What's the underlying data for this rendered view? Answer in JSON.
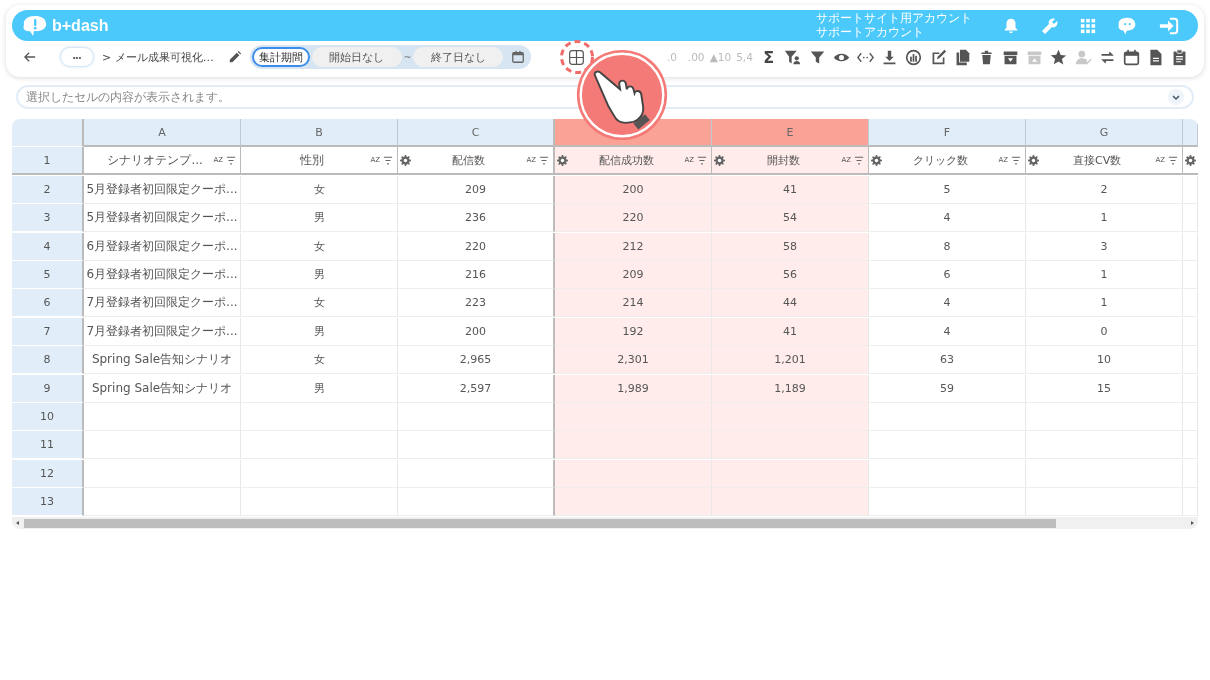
{
  "header": {
    "logo": "b+dash",
    "account": [
      "サポートサイト用アカウント",
      "サポートアカウント"
    ]
  },
  "breadcrumb": {
    "more": "•••",
    "title": "> メール成果可視化…"
  },
  "period": {
    "tabs": [
      {
        "label": "集計期間",
        "selected": true
      },
      {
        "label": "開始日なし",
        "selected": false
      }
    ],
    "separator": "~",
    "end": "終了日なし"
  },
  "toolbar": [
    {
      "kind": "icon",
      "disabled": false,
      "highlighted": true
    },
    {
      "kind": "text",
      "label": ".0",
      "disabled": true
    },
    {
      "kind": "text",
      "label": ".00",
      "disabled": true
    },
    {
      "kind": "text",
      "label": "▲10",
      "disabled": true
    },
    {
      "kind": "text",
      "label": "5,4",
      "disabled": true
    },
    {
      "kind": "text",
      "label": "Σ",
      "disabled": false
    },
    {
      "kind": "icon",
      "disabled": false
    },
    {
      "kind": "icon",
      "disabled": false
    },
    {
      "kind": "icon",
      "disabled": false
    },
    {
      "kind": "icon",
      "disabled": false
    },
    {
      "kind": "icon",
      "disabled": false
    },
    {
      "kind": "icon",
      "disabled": false
    },
    {
      "kind": "icon",
      "disabled": false
    },
    {
      "kind": "icon",
      "disabled": false
    },
    {
      "kind": "icon",
      "disabled": false
    },
    {
      "kind": "icon",
      "disabled": false
    },
    {
      "kind": "icon",
      "disabled": true
    },
    {
      "kind": "icon",
      "disabled": false
    },
    {
      "kind": "icon",
      "disabled": true
    },
    {
      "kind": "icon",
      "disabled": false
    },
    {
      "kind": "icon",
      "disabled": false
    },
    {
      "kind": "icon",
      "disabled": false
    },
    {
      "kind": "icon",
      "disabled": false
    }
  ],
  "formula_bar": {
    "placeholder": "選択したセルの内容が表示されます。"
  },
  "table": {
    "columns": [
      {
        "letter": "A",
        "title": "シナリオテンプ...",
        "sort": "AZ",
        "settings": false,
        "selected": false
      },
      {
        "letter": "B",
        "title": "性別",
        "sort": "AZ",
        "settings": false,
        "selected": false
      },
      {
        "letter": "C",
        "title": "配信数",
        "sort": "AZ",
        "settings": true,
        "selected": false
      },
      {
        "title": "配信成功数",
        "sort": "AZ",
        "settings": true,
        "selected": true
      },
      {
        "letter": "E",
        "title": "開封数",
        "sort": "AZ",
        "settings": true,
        "selected": true
      },
      {
        "letter": "F",
        "title": "クリック数",
        "sort": "AZ",
        "settings": true,
        "selected": false
      },
      {
        "letter": "G",
        "title": "直接CV数",
        "sort": "AZ",
        "settings": true,
        "selected": false
      }
    ],
    "header_row": "1",
    "rows": [
      {
        "number": "2",
        "cells": [
          "5月登録者初回限定クーポ...",
          "女",
          "209",
          "200",
          "41",
          "5",
          "2"
        ]
      },
      {
        "number": "3",
        "cells": [
          "5月登録者初回限定クーポ...",
          "男",
          "236",
          "220",
          "54",
          "4",
          "1"
        ]
      },
      {
        "number": "4",
        "cells": [
          "6月登録者初回限定クーポ...",
          "女",
          "220",
          "212",
          "58",
          "8",
          "3"
        ]
      },
      {
        "number": "5",
        "cells": [
          "6月登録者初回限定クーポ...",
          "男",
          "216",
          "209",
          "56",
          "6",
          "1"
        ]
      },
      {
        "number": "6",
        "cells": [
          "7月登録者初回限定クーポ...",
          "女",
          "223",
          "214",
          "44",
          "4",
          "1"
        ]
      },
      {
        "number": "7",
        "cells": [
          "7月登録者初回限定クーポ...",
          "男",
          "200",
          "192",
          "41",
          "4",
          "0"
        ]
      },
      {
        "number": "8",
        "cells": [
          "Spring Sale告知シナリオ",
          "女",
          "2,965",
          "2,301",
          "1,201",
          "63",
          "10"
        ]
      },
      {
        "number": "9",
        "cells": [
          "Spring Sale告知シナリオ",
          "男",
          "2,597",
          "1,989",
          "1,189",
          "59",
          "15"
        ]
      },
      {
        "number": "10"
      },
      {
        "number": "11"
      },
      {
        "number": "12"
      },
      {
        "number": "13"
      }
    ]
  }
}
